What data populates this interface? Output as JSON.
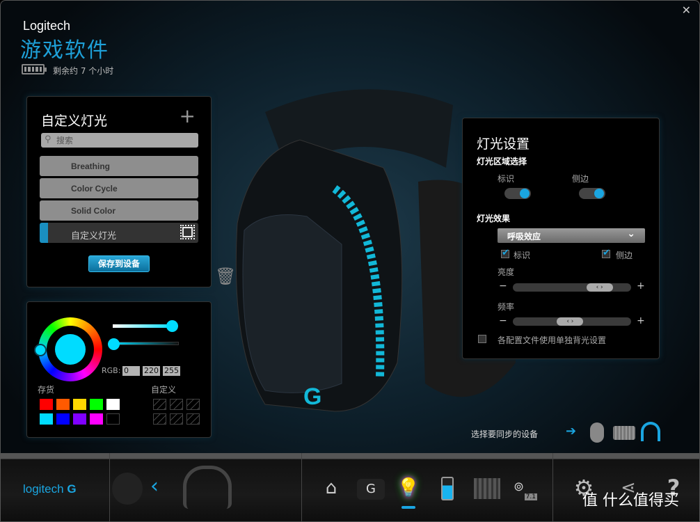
{
  "window": {
    "brand": "Logitech",
    "title": "游戏软件",
    "battery_text": "剩余约 7 个小时",
    "battery_level": 1.0,
    "close": "✕"
  },
  "lighting_list": {
    "title": "自定义灯光",
    "add": "+",
    "search_placeholder": "搜索",
    "items": [
      {
        "label": "Breathing"
      },
      {
        "label": "Color Cycle"
      },
      {
        "label": "Solid Color"
      },
      {
        "label": "自定义灯光",
        "selected": true
      }
    ],
    "save": "保存到设备"
  },
  "color": {
    "selected_hex": "#00dcff",
    "rgb_label": "RGB:",
    "r": "0",
    "g": "220",
    "b": "255",
    "stock_label": "存货",
    "custom_label": "自定义",
    "stock": [
      "#ff0000",
      "#ff5a00",
      "#ffd800",
      "#00ff00",
      "#ffffff",
      "#00dcff",
      "#0000ff",
      "#8000ff",
      "#ff00ff",
      "#000000"
    ],
    "saturation": 1.0,
    "brightness": 0.0
  },
  "settings": {
    "title": "灯光设置",
    "zone_title": "灯光区域选择",
    "zones": [
      {
        "label": "标识",
        "on": true
      },
      {
        "label": "侧边",
        "on": true
      }
    ],
    "effect_title": "灯光效果",
    "effect": "呼吸效应",
    "checks": [
      {
        "label": "标识",
        "checked": true
      },
      {
        "label": "侧边",
        "checked": true
      }
    ],
    "brightness_label": "亮度",
    "brightness": 0.8,
    "rate_label": "频率",
    "rate": 0.48,
    "per_profile": "各配置文件使用单独背光设置",
    "per_profile_checked": false,
    "minus": "−",
    "plus": "+"
  },
  "sync": {
    "label": "选择要同步的设备",
    "arrow": "➔"
  },
  "bottom": {
    "logo": "logitech",
    "watermark": "值 什么值得买",
    "badge": "7.1"
  },
  "accent": "#1aa5e0"
}
